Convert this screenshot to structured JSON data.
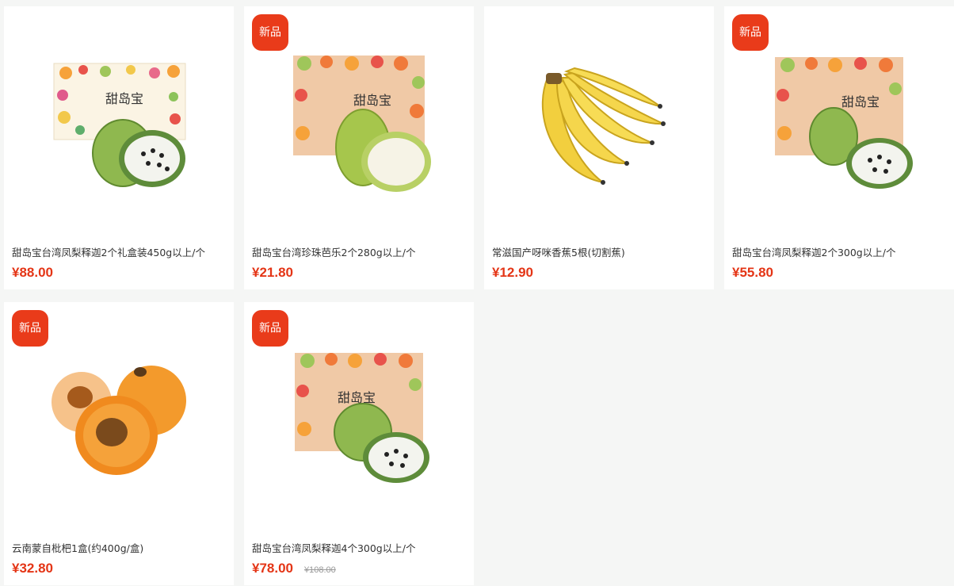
{
  "products": [
    {
      "name": "甜岛宝台湾凤梨释迦2个礼盒装450g以上/个",
      "price": "¥88.00",
      "original_price": "",
      "badge": "",
      "image": "cherimoya-giftbox-image"
    },
    {
      "name": "甜岛宝台湾珍珠芭乐2个280g以上/个",
      "price": "¥21.80",
      "original_price": "",
      "badge": "新品",
      "image": "guava-giftbox-image"
    },
    {
      "name": "常滋国产呀咪香蕉5根(切割蕉)",
      "price": "¥12.90",
      "original_price": "",
      "badge": "",
      "image": "banana-bunch-image"
    },
    {
      "name": "甜岛宝台湾凤梨释迦2个300g以上/个",
      "price": "¥55.80",
      "original_price": "",
      "badge": "新品",
      "image": "cherimoya-box-image"
    },
    {
      "name": "云南蒙自枇杷1盒(约400g/盒)",
      "price": "¥32.80",
      "original_price": "",
      "badge": "新品",
      "image": "loquat-image"
    },
    {
      "name": "甜岛宝台湾凤梨释迦4个300g以上/个",
      "price": "¥78.00",
      "original_price": "¥108.00",
      "badge": "新品",
      "image": "cherimoya-box-image"
    }
  ],
  "box_brand_text": "甜岛宝",
  "colors": {
    "badge": "#e93b1a",
    "price": "#e43516",
    "background": "#f5f6f5"
  }
}
